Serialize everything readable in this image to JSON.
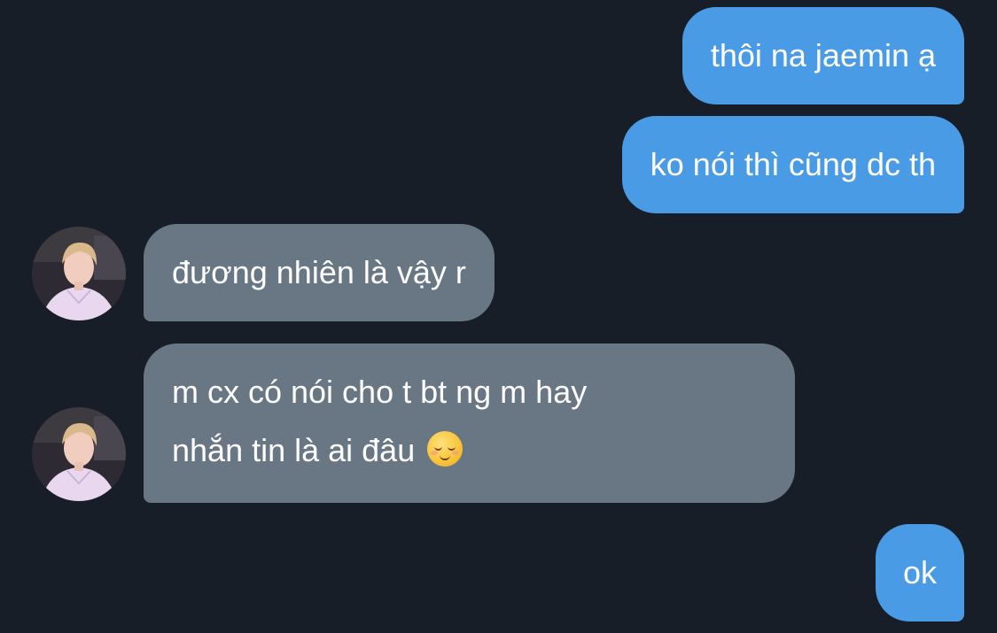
{
  "messages": [
    {
      "direction": "out",
      "text": "thôi na jaemin ạ"
    },
    {
      "direction": "out",
      "text": "ko nói thì cũng dc th"
    },
    {
      "direction": "in",
      "text": "đương nhiên là vậy r"
    },
    {
      "direction": "in",
      "line1": "m cx có nói cho t bt ng m hay",
      "line2": "nhắn tin là ai đâu",
      "emoji": "relieved-face-emoji"
    },
    {
      "direction": "out",
      "text": "ok"
    }
  ],
  "colors": {
    "background": "#171e27",
    "outgoing_bubble": "#4a9be6",
    "incoming_bubble": "#697684",
    "text": "#ffffff"
  },
  "icons": {
    "avatar": "contact-avatar-photo"
  }
}
